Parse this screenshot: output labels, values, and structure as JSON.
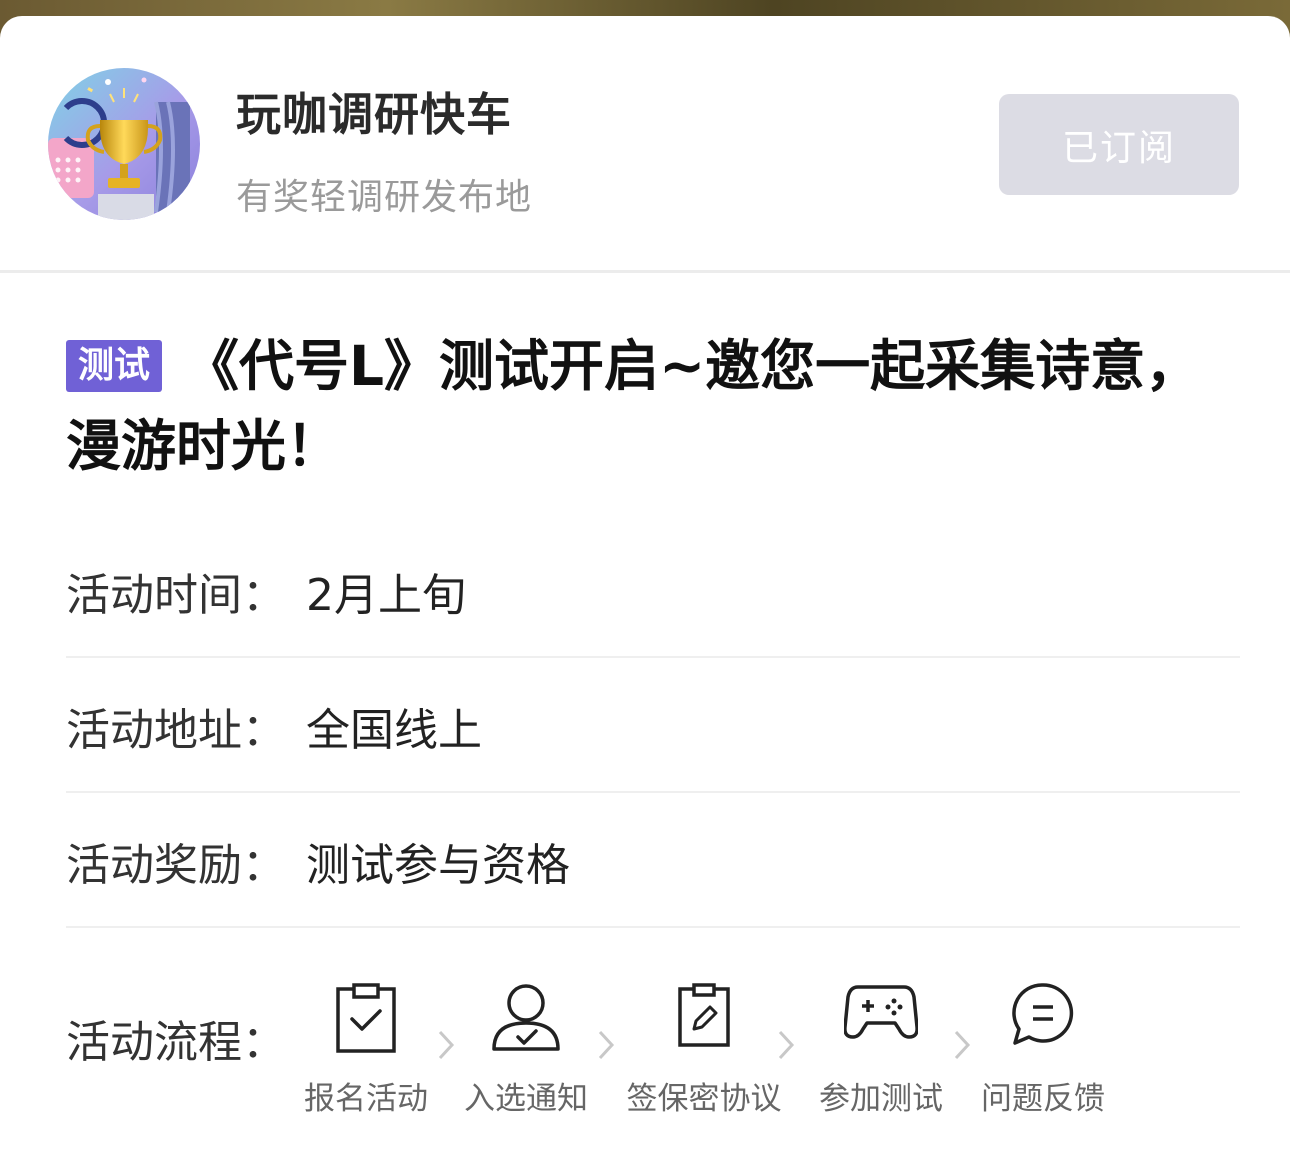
{
  "header": {
    "channel_name": "玩咖调研快车",
    "channel_desc": "有奖轻调研发布地",
    "subscribe_label": "已订阅"
  },
  "article": {
    "tag": "测试",
    "title": "《代号L》测试开启~邀您一起采集诗意，漫游时光！"
  },
  "info": [
    {
      "label": "活动时间：",
      "value": "2月上旬"
    },
    {
      "label": "活动地址：",
      "value": "全国线上"
    },
    {
      "label": "活动奖励：",
      "value": "测试参与资格"
    }
  ],
  "process": {
    "label": "活动流程：",
    "steps": [
      {
        "label": "报名活动",
        "icon": "clipboard-check-icon"
      },
      {
        "label": "入选通知",
        "icon": "user-check-icon"
      },
      {
        "label": "签保密协议",
        "icon": "clipboard-edit-icon"
      },
      {
        "label": "参加测试",
        "icon": "gamepad-icon"
      },
      {
        "label": "问题反馈",
        "icon": "chat-bubble-icon"
      }
    ]
  },
  "colors": {
    "tag_bg": "#7061d6",
    "subscribed_bg": "#dcdce4",
    "muted_text": "#9a9a9a"
  }
}
